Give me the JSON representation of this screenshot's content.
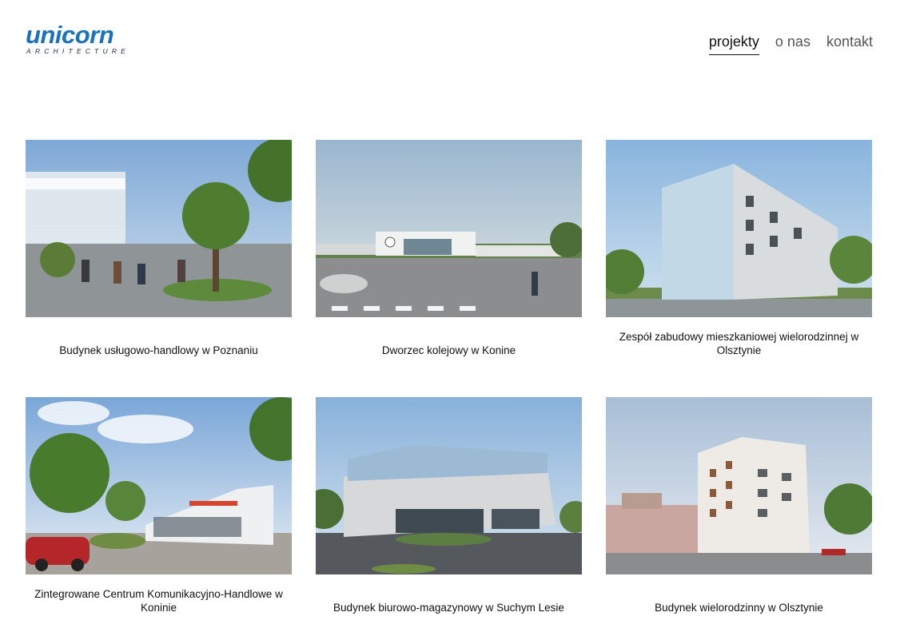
{
  "brand": {
    "logo_word": "unicorn",
    "logo_sub": "ARCHITECTURE"
  },
  "nav": {
    "items": [
      {
        "label": "projekty",
        "active": true
      },
      {
        "label": "o nas",
        "active": false
      },
      {
        "label": "kontakt",
        "active": false
      }
    ]
  },
  "projects": [
    {
      "title": "Budynek usługowo-handlowy w Poznaniu"
    },
    {
      "title": "Dworzec kolejowy w Konine"
    },
    {
      "title": "Zespół zabudowy mieszkaniowej wielorodzinnej w Olsztynie"
    },
    {
      "title": "Zintegrowane Centrum Komunikacyjno-Handlowe w Koninie"
    },
    {
      "title": "Budynek biurowo-magazynowy w Suchym Lesie"
    },
    {
      "title": "Budynek wielorodzinny w Olsztynie"
    }
  ],
  "colors": {
    "brand": "#1a72bd",
    "text": "#111111",
    "nav": "#555555"
  }
}
